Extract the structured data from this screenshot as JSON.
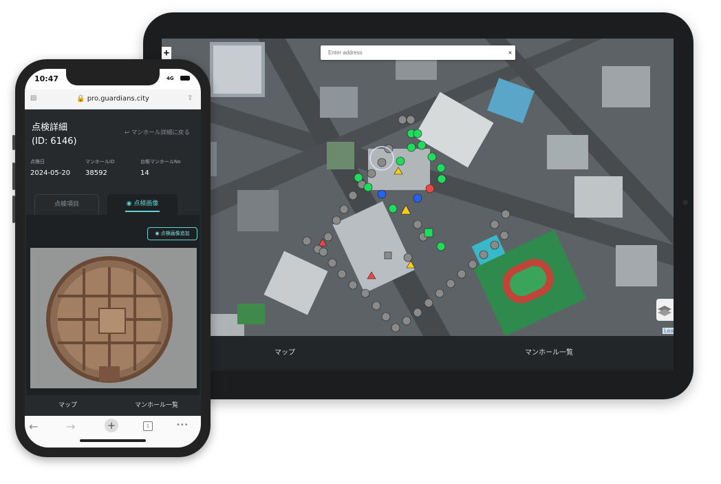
{
  "tablet": {
    "address_placeholder": "Enter address",
    "clear_label": "×",
    "zoom_in": "+",
    "attribution": "Lea",
    "nav": {
      "map": "マップ",
      "list": "マンホール一覧"
    }
  },
  "phone": {
    "status": {
      "time": "10:47",
      "network": "4G"
    },
    "browser": {
      "url": "pro.guardians.city"
    },
    "page": {
      "title": "点検詳細",
      "id_label": "(ID: 6146)",
      "back_link": "↩ マンホール詳細に戻る"
    },
    "meta": [
      {
        "label": "点検日",
        "value": "2024-05-20"
      },
      {
        "label": "マンホールID",
        "value": "38592"
      },
      {
        "label": "台帳マンホールNo",
        "value": "14"
      }
    ],
    "tabs": {
      "items": "点検項目",
      "images": "点検画像"
    },
    "add_image_button": "点検画像追加",
    "nav": {
      "map": "マップ",
      "list": "マンホール一覧"
    },
    "toolbar": {
      "back": "←",
      "forward": "→",
      "new_tab": "+",
      "tab_count": "1",
      "more": "•••"
    }
  },
  "colors": {
    "accent": "#5fd6d1",
    "marker_good": "#1fdc5c",
    "marker_neutral": "#8a8a8a",
    "marker_bad": "#ef4444",
    "marker_blue": "#2563eb",
    "warning": "#facc15"
  }
}
